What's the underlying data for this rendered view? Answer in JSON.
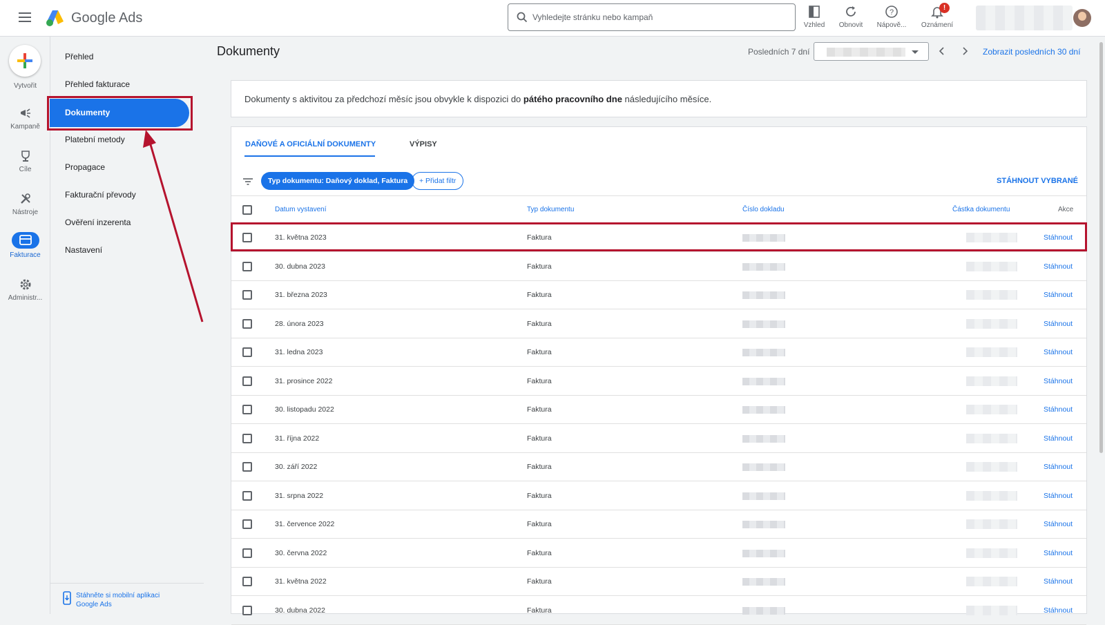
{
  "app": {
    "name": "Google Ads"
  },
  "header": {
    "search_placeholder": "Vyhledejte stránku nebo kampaň",
    "tools": [
      {
        "label": "Vzhled",
        "icon": "appearance-icon"
      },
      {
        "label": "Obnovit",
        "icon": "refresh-icon"
      },
      {
        "label": "Nápově...",
        "icon": "help-icon"
      },
      {
        "label": "Oznámení",
        "icon": "bell-icon",
        "badge": "!"
      }
    ]
  },
  "rail": {
    "items": [
      {
        "label": "Vytvořit",
        "icon": "plus-icon"
      },
      {
        "label": "Kampaně",
        "icon": "megaphone-icon"
      },
      {
        "label": "Cíle",
        "icon": "trophy-icon"
      },
      {
        "label": "Nástroje",
        "icon": "tools-icon"
      },
      {
        "label": "Fakturace",
        "icon": "credit-card-icon",
        "active": true
      },
      {
        "label": "Administr...",
        "icon": "gear-icon"
      }
    ]
  },
  "subnav": {
    "items": [
      {
        "label": "Přehled"
      },
      {
        "label": "Přehled fakturace"
      },
      {
        "label": "Dokumenty",
        "active": true
      },
      {
        "label": "Platební metody"
      },
      {
        "label": "Propagace"
      },
      {
        "label": "Fakturační převody"
      },
      {
        "label": "Ověření inzerenta"
      },
      {
        "label": "Nastavení"
      }
    ],
    "mobile_link": "Stáhněte si mobilní aplikaci Google Ads"
  },
  "page": {
    "title": "Dokumenty",
    "date_range_label": "Posledních 7 dní",
    "show_last_30": "Zobrazit posledních 30 dní"
  },
  "notice": {
    "text_before": "Dokumenty s aktivitou za předchozí měsíc jsou obvykle k dispozici do ",
    "text_bold": "pátého pracovního dne",
    "text_after": " následujícího měsíce."
  },
  "documents": {
    "tabs": [
      {
        "label": "DAŇOVÉ A OFICIÁLNÍ DOKUMENTY",
        "active": true
      },
      {
        "label": "VÝPISY",
        "active": false
      }
    ],
    "filter_chip": "Typ dokumentu: Daňový doklad, Faktura",
    "add_filter": "+ Přidat filtr",
    "download_selected": "STÁHNOUT VYBRANÉ",
    "columns": [
      "Datum vystavení",
      "Typ dokumentu",
      "Číslo dokladu",
      "Částka dokumentu",
      "Akce"
    ],
    "rows": [
      {
        "date": "31. května 2023",
        "type": "Faktura",
        "action": "Stáhnout"
      },
      {
        "date": "30. dubna 2023",
        "type": "Faktura",
        "action": "Stáhnout"
      },
      {
        "date": "31. března 2023",
        "type": "Faktura",
        "action": "Stáhnout"
      },
      {
        "date": "28. února 2023",
        "type": "Faktura",
        "action": "Stáhnout"
      },
      {
        "date": "31. ledna 2023",
        "type": "Faktura",
        "action": "Stáhnout"
      },
      {
        "date": "31. prosince 2022",
        "type": "Faktura",
        "action": "Stáhnout"
      },
      {
        "date": "30. listopadu 2022",
        "type": "Faktura",
        "action": "Stáhnout"
      },
      {
        "date": "31. října 2022",
        "type": "Faktura",
        "action": "Stáhnout"
      },
      {
        "date": "30. září 2022",
        "type": "Faktura",
        "action": "Stáhnout"
      },
      {
        "date": "31. srpna 2022",
        "type": "Faktura",
        "action": "Stáhnout"
      },
      {
        "date": "31. července 2022",
        "type": "Faktura",
        "action": "Stáhnout"
      },
      {
        "date": "30. června 2022",
        "type": "Faktura",
        "action": "Stáhnout"
      },
      {
        "date": "31. května 2022",
        "type": "Faktura",
        "action": "Stáhnout"
      },
      {
        "date": "30. dubna 2022",
        "type": "Faktura",
        "action": "Stáhnout"
      }
    ]
  },
  "colors": {
    "accent": "#1a73e8",
    "highlight": "#b5132e",
    "badge": "#d93025"
  }
}
